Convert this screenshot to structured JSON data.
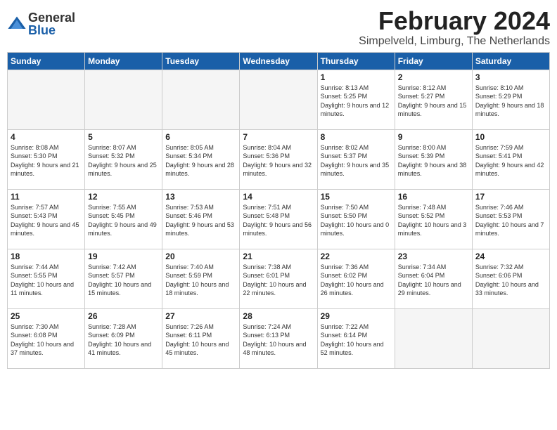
{
  "logo": {
    "general": "General",
    "blue": "Blue"
  },
  "title": {
    "month_year": "February 2024",
    "location": "Simpelveld, Limburg, The Netherlands"
  },
  "weekdays": [
    "Sunday",
    "Monday",
    "Tuesday",
    "Wednesday",
    "Thursday",
    "Friday",
    "Saturday"
  ],
  "weeks": [
    [
      {
        "day": "",
        "info": ""
      },
      {
        "day": "",
        "info": ""
      },
      {
        "day": "",
        "info": ""
      },
      {
        "day": "",
        "info": ""
      },
      {
        "day": "1",
        "info": "Sunrise: 8:13 AM\nSunset: 5:25 PM\nDaylight: 9 hours\nand 12 minutes."
      },
      {
        "day": "2",
        "info": "Sunrise: 8:12 AM\nSunset: 5:27 PM\nDaylight: 9 hours\nand 15 minutes."
      },
      {
        "day": "3",
        "info": "Sunrise: 8:10 AM\nSunset: 5:29 PM\nDaylight: 9 hours\nand 18 minutes."
      }
    ],
    [
      {
        "day": "4",
        "info": "Sunrise: 8:08 AM\nSunset: 5:30 PM\nDaylight: 9 hours\nand 21 minutes."
      },
      {
        "day": "5",
        "info": "Sunrise: 8:07 AM\nSunset: 5:32 PM\nDaylight: 9 hours\nand 25 minutes."
      },
      {
        "day": "6",
        "info": "Sunrise: 8:05 AM\nSunset: 5:34 PM\nDaylight: 9 hours\nand 28 minutes."
      },
      {
        "day": "7",
        "info": "Sunrise: 8:04 AM\nSunset: 5:36 PM\nDaylight: 9 hours\nand 32 minutes."
      },
      {
        "day": "8",
        "info": "Sunrise: 8:02 AM\nSunset: 5:37 PM\nDaylight: 9 hours\nand 35 minutes."
      },
      {
        "day": "9",
        "info": "Sunrise: 8:00 AM\nSunset: 5:39 PM\nDaylight: 9 hours\nand 38 minutes."
      },
      {
        "day": "10",
        "info": "Sunrise: 7:59 AM\nSunset: 5:41 PM\nDaylight: 9 hours\nand 42 minutes."
      }
    ],
    [
      {
        "day": "11",
        "info": "Sunrise: 7:57 AM\nSunset: 5:43 PM\nDaylight: 9 hours\nand 45 minutes."
      },
      {
        "day": "12",
        "info": "Sunrise: 7:55 AM\nSunset: 5:45 PM\nDaylight: 9 hours\nand 49 minutes."
      },
      {
        "day": "13",
        "info": "Sunrise: 7:53 AM\nSunset: 5:46 PM\nDaylight: 9 hours\nand 53 minutes."
      },
      {
        "day": "14",
        "info": "Sunrise: 7:51 AM\nSunset: 5:48 PM\nDaylight: 9 hours\nand 56 minutes."
      },
      {
        "day": "15",
        "info": "Sunrise: 7:50 AM\nSunset: 5:50 PM\nDaylight: 10 hours\nand 0 minutes."
      },
      {
        "day": "16",
        "info": "Sunrise: 7:48 AM\nSunset: 5:52 PM\nDaylight: 10 hours\nand 3 minutes."
      },
      {
        "day": "17",
        "info": "Sunrise: 7:46 AM\nSunset: 5:53 PM\nDaylight: 10 hours\nand 7 minutes."
      }
    ],
    [
      {
        "day": "18",
        "info": "Sunrise: 7:44 AM\nSunset: 5:55 PM\nDaylight: 10 hours\nand 11 minutes."
      },
      {
        "day": "19",
        "info": "Sunrise: 7:42 AM\nSunset: 5:57 PM\nDaylight: 10 hours\nand 15 minutes."
      },
      {
        "day": "20",
        "info": "Sunrise: 7:40 AM\nSunset: 5:59 PM\nDaylight: 10 hours\nand 18 minutes."
      },
      {
        "day": "21",
        "info": "Sunrise: 7:38 AM\nSunset: 6:01 PM\nDaylight: 10 hours\nand 22 minutes."
      },
      {
        "day": "22",
        "info": "Sunrise: 7:36 AM\nSunset: 6:02 PM\nDaylight: 10 hours\nand 26 minutes."
      },
      {
        "day": "23",
        "info": "Sunrise: 7:34 AM\nSunset: 6:04 PM\nDaylight: 10 hours\nand 29 minutes."
      },
      {
        "day": "24",
        "info": "Sunrise: 7:32 AM\nSunset: 6:06 PM\nDaylight: 10 hours\nand 33 minutes."
      }
    ],
    [
      {
        "day": "25",
        "info": "Sunrise: 7:30 AM\nSunset: 6:08 PM\nDaylight: 10 hours\nand 37 minutes."
      },
      {
        "day": "26",
        "info": "Sunrise: 7:28 AM\nSunset: 6:09 PM\nDaylight: 10 hours\nand 41 minutes."
      },
      {
        "day": "27",
        "info": "Sunrise: 7:26 AM\nSunset: 6:11 PM\nDaylight: 10 hours\nand 45 minutes."
      },
      {
        "day": "28",
        "info": "Sunrise: 7:24 AM\nSunset: 6:13 PM\nDaylight: 10 hours\nand 48 minutes."
      },
      {
        "day": "29",
        "info": "Sunrise: 7:22 AM\nSunset: 6:14 PM\nDaylight: 10 hours\nand 52 minutes."
      },
      {
        "day": "",
        "info": ""
      },
      {
        "day": "",
        "info": ""
      }
    ]
  ]
}
